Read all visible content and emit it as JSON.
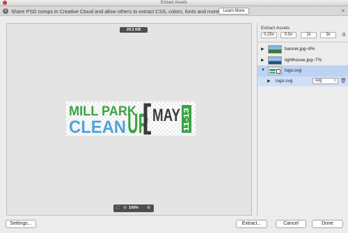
{
  "window": {
    "title": "Extract Assets"
  },
  "banner": {
    "message": "Share PSD comps in Creative Cloud and allow others to extract CSS, colors, fonts and more",
    "learn_more_label": "Learn More",
    "info_icon": "info-icon",
    "close_icon": "close-icon"
  },
  "preview": {
    "file_size": "29.3 KB",
    "zoom_level": "100%",
    "zoom_out_glyph": "⊖",
    "zoom_in_glyph": "⊕",
    "fit_glyph": "⛶",
    "logo": {
      "line1": "MILL PARK",
      "line2a": "CLEAN",
      "line2b": "UP",
      "month": "MAY",
      "days": "11-13"
    }
  },
  "panel": {
    "title": "Extract Assets",
    "scales": [
      "0.25x",
      "0.5x",
      "2x",
      "3x"
    ],
    "settings_icon": "gear-icon",
    "assets": [
      {
        "name": "banner.jpg~8%",
        "expanded": false,
        "selected": false
      },
      {
        "name": "lighthouse.jpg~7%",
        "expanded": false,
        "selected": false
      },
      {
        "name": "logo.svg",
        "expanded": true,
        "selected": true
      }
    ],
    "sub_asset": {
      "name": "logo.svg",
      "format": "svg"
    }
  },
  "footer": {
    "settings_label": "Settings...",
    "extract_label": "Extract...",
    "cancel_label": "Cancel",
    "done_label": "Done"
  },
  "colors": {
    "selection": "#bcd3f4",
    "logo_green": "#3aa346",
    "logo_blue": "#4fa3dc",
    "logo_dark": "#3a3a3a"
  }
}
